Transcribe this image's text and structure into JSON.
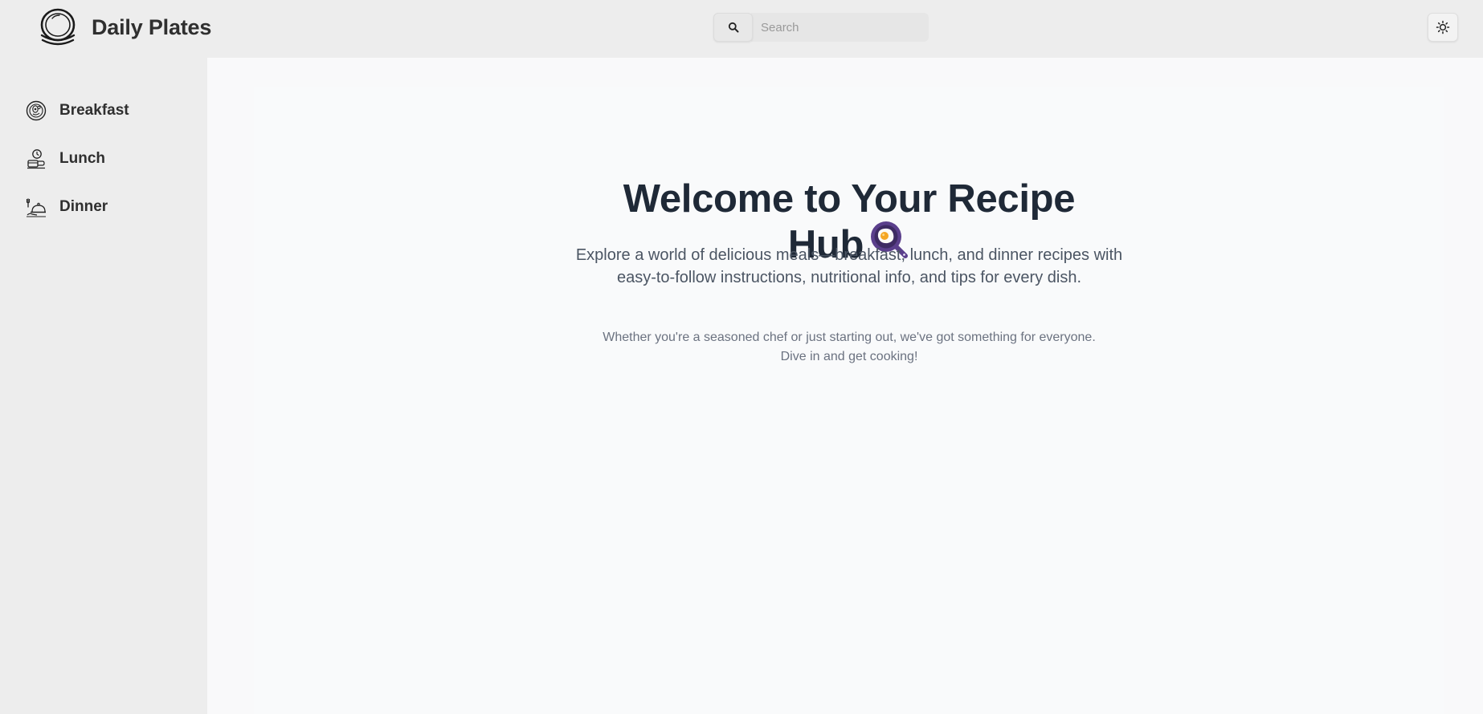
{
  "header": {
    "brand_title": "Daily Plates",
    "brand_icon": "plate-stack-icon",
    "search": {
      "placeholder": "Search",
      "value": "",
      "icon": "search-icon"
    },
    "theme_toggle_icon": "sun-icon"
  },
  "sidebar": {
    "items": [
      {
        "label": "Breakfast",
        "icon": "breakfast-plate-icon"
      },
      {
        "label": "Lunch",
        "icon": "lunch-icon"
      },
      {
        "label": "Dinner",
        "icon": "dinner-cloche-icon"
      }
    ]
  },
  "main": {
    "title_line1": "Welcome to Your Recipe",
    "title_line2": "Hub",
    "title_emoji_icon": "frying-pan-egg-icon",
    "subtitle": "Explore a world of delicious meals—breakfast, lunch, and dinner recipes with easy-to-follow instructions, nutritional info, and tips for every dish.",
    "note_line1": "Whether you're a seasoned chef or just starting out, we've got something for everyone.",
    "note_line2": "Dive in and get cooking!"
  },
  "colors": {
    "chrome_bg": "#ededed",
    "content_bg": "#f9fafb",
    "title": "#1f2937",
    "subtitle": "#4b5563",
    "note": "#6b7280",
    "pan": "#5b3f8c"
  }
}
